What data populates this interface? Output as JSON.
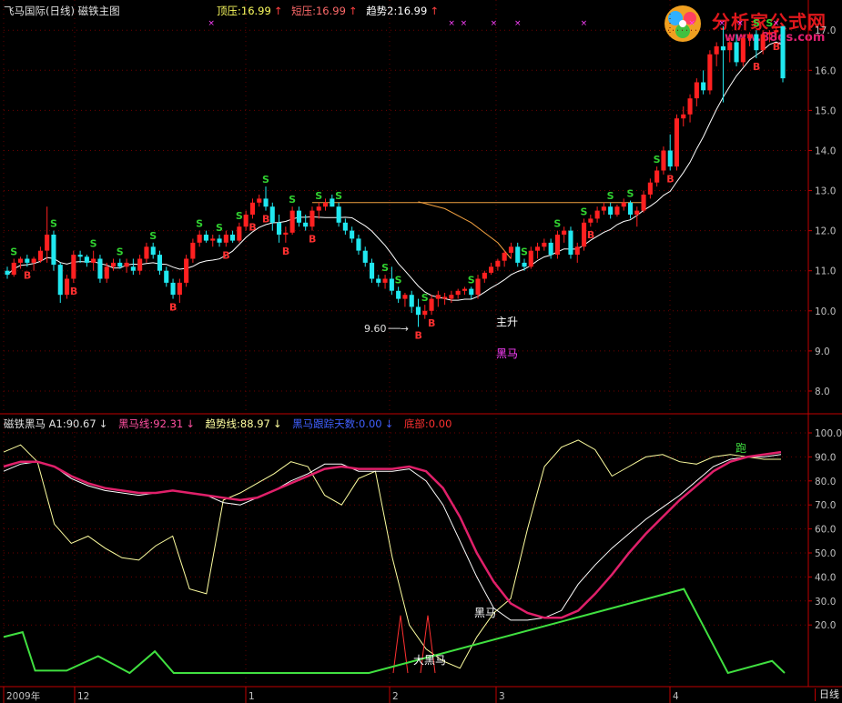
{
  "main_header": {
    "title": "飞马国际(日线)  磁铁主图",
    "top_press_label": "顶压:16.99",
    "short_press_label": "短压:16.99",
    "trend_label": "趋势2:16.99",
    "arrow": "↑"
  },
  "sub_header": {
    "title": "磁铁黑马  A1:90.67",
    "heima_line": "黑马线:92.31",
    "trend_line": "趋势线:88.97",
    "follow_days": "黑马跟踪天数:0.00",
    "bottom": "底部:0.00",
    "arrow": "↓"
  },
  "logo": {
    "name": "分析家公式网",
    "url": "www.88gs.com"
  },
  "annotations": {
    "low_price": "9.60",
    "main_rise": "主升",
    "dark_horse": "黑马",
    "sub_dark_horse": "黑马",
    "big_dark_horse": "大黑马",
    "run": "跑"
  },
  "price_axis": [
    "17.0",
    "16.0",
    "15.0",
    "14.0",
    "13.0",
    "12.0",
    "11.0",
    "10.0",
    "9.0",
    "8.0"
  ],
  "osc_axis": [
    "100.0",
    "90.0",
    "80.0",
    "70.0",
    "60.0",
    "50.0",
    "40.0",
    "30.0",
    "20.0"
  ],
  "date_axis": [
    "2009年",
    "12",
    "1",
    "2",
    "3",
    "4"
  ],
  "period_button": "日线",
  "colors": {
    "up": "#ff2020",
    "down": "#20e8f0",
    "buy": "#ff3030",
    "sell": "#30d030",
    "heima": "#e0206a",
    "trend": "#ffffa0",
    "green": "#40e040"
  },
  "chart_data": [
    {
      "type": "candlestick",
      "ylim": [
        7.5,
        17.3
      ],
      "candles": [
        [
          11.0,
          11.1,
          10.8,
          10.9
        ],
        [
          10.9,
          11.3,
          10.85,
          11.2
        ],
        [
          11.2,
          11.35,
          11.05,
          11.3
        ],
        [
          11.3,
          11.4,
          11.1,
          11.2
        ],
        [
          11.2,
          11.35,
          11.0,
          11.3
        ],
        [
          11.25,
          11.6,
          11.2,
          11.5
        ],
        [
          11.5,
          12.6,
          11.2,
          11.9
        ],
        [
          11.9,
          12.0,
          11.0,
          11.15
        ],
        [
          11.15,
          11.2,
          10.2,
          10.4
        ],
        [
          10.4,
          10.9,
          10.3,
          10.8
        ],
        [
          10.8,
          11.5,
          10.7,
          11.4
        ],
        [
          11.4,
          11.5,
          11.2,
          11.35
        ],
        [
          11.35,
          11.4,
          11.1,
          11.2
        ],
        [
          11.2,
          11.5,
          11.0,
          11.3
        ],
        [
          11.3,
          11.4,
          10.7,
          10.8
        ],
        [
          10.8,
          11.2,
          10.7,
          11.1
        ],
        [
          11.1,
          11.3,
          11.0,
          11.2
        ],
        [
          11.2,
          11.3,
          11.05,
          11.1
        ],
        [
          11.1,
          11.3,
          10.95,
          11.2
        ],
        [
          11.1,
          11.3,
          10.9,
          11.0
        ],
        [
          11.0,
          11.4,
          10.9,
          11.3
        ],
        [
          11.3,
          11.7,
          11.2,
          11.6
        ],
        [
          11.6,
          11.7,
          11.3,
          11.4
        ],
        [
          11.4,
          11.5,
          10.9,
          11.0
        ],
        [
          11.0,
          11.1,
          10.6,
          10.7
        ],
        [
          10.7,
          10.8,
          10.3,
          10.4
        ],
        [
          10.4,
          10.8,
          10.2,
          10.7
        ],
        [
          10.7,
          11.4,
          10.6,
          11.3
        ],
        [
          11.3,
          11.8,
          11.2,
          11.7
        ],
        [
          11.7,
          12.0,
          11.6,
          11.9
        ],
        [
          11.9,
          12.0,
          11.7,
          11.75
        ],
        [
          11.75,
          11.9,
          11.6,
          11.8
        ],
        [
          11.8,
          11.9,
          11.6,
          11.7
        ],
        [
          11.7,
          12.0,
          11.6,
          11.9
        ],
        [
          11.9,
          12.0,
          11.7,
          11.75
        ],
        [
          11.75,
          12.2,
          11.7,
          12.1
        ],
        [
          12.1,
          12.5,
          12.0,
          12.4
        ],
        [
          12.4,
          12.8,
          12.3,
          12.7
        ],
        [
          12.7,
          12.9,
          12.6,
          12.8
        ],
        [
          12.8,
          13.1,
          12.5,
          12.6
        ],
        [
          12.6,
          12.7,
          12.0,
          12.2
        ],
        [
          12.2,
          12.4,
          11.7,
          11.9
        ],
        [
          11.9,
          12.1,
          11.7,
          11.95
        ],
        [
          11.95,
          12.6,
          11.9,
          12.5
        ],
        [
          12.5,
          12.6,
          12.1,
          12.2
        ],
        [
          12.2,
          12.4,
          12.0,
          12.1
        ],
        [
          12.1,
          12.6,
          12.0,
          12.5
        ],
        [
          12.5,
          12.7,
          12.3,
          12.6
        ],
        [
          12.6,
          12.8,
          12.5,
          12.7
        ],
        [
          12.8,
          12.9,
          12.6,
          12.6
        ],
        [
          12.6,
          12.7,
          12.1,
          12.2
        ],
        [
          12.2,
          12.3,
          11.9,
          12.0
        ],
        [
          12.0,
          12.1,
          11.7,
          11.8
        ],
        [
          11.8,
          11.9,
          11.4,
          11.5
        ],
        [
          11.5,
          11.6,
          11.1,
          11.2
        ],
        [
          11.2,
          11.3,
          10.7,
          10.8
        ],
        [
          10.8,
          10.9,
          10.6,
          10.7
        ],
        [
          10.7,
          10.9,
          10.55,
          10.8
        ],
        [
          10.8,
          11.1,
          10.4,
          10.5
        ],
        [
          10.5,
          10.6,
          10.2,
          10.3
        ],
        [
          10.3,
          10.45,
          10.1,
          10.4
        ],
        [
          10.4,
          10.5,
          9.95,
          10.1
        ],
        [
          10.1,
          10.3,
          9.6,
          9.9
        ],
        [
          9.9,
          10.15,
          9.8,
          10.0
        ],
        [
          10.0,
          10.4,
          9.9,
          10.3
        ],
        [
          10.3,
          10.5,
          10.1,
          10.4
        ],
        [
          10.3,
          10.45,
          10.15,
          10.35
        ],
        [
          10.3,
          10.5,
          10.2,
          10.4
        ],
        [
          10.4,
          10.55,
          10.3,
          10.5
        ],
        [
          10.5,
          10.6,
          10.4,
          10.55
        ],
        [
          10.55,
          10.6,
          10.3,
          10.4
        ],
        [
          10.4,
          10.9,
          10.3,
          10.8
        ],
        [
          10.8,
          11.0,
          10.7,
          10.95
        ],
        [
          10.95,
          11.2,
          10.9,
          11.1
        ],
        [
          11.1,
          11.3,
          11.0,
          11.25
        ],
        [
          11.25,
          11.5,
          11.1,
          11.45
        ],
        [
          11.45,
          11.7,
          11.3,
          11.6
        ],
        [
          11.6,
          11.7,
          11.1,
          11.2
        ],
        [
          11.2,
          11.3,
          11.0,
          11.1
        ],
        [
          11.1,
          11.6,
          11.05,
          11.5
        ],
        [
          11.5,
          11.7,
          11.3,
          11.6
        ],
        [
          11.6,
          11.8,
          11.5,
          11.7
        ],
        [
          11.7,
          11.8,
          11.3,
          11.4
        ],
        [
          11.4,
          12.0,
          11.3,
          11.9
        ],
        [
          11.9,
          12.1,
          11.7,
          12.0
        ],
        [
          12.0,
          12.1,
          11.3,
          11.4
        ],
        [
          11.4,
          11.7,
          11.2,
          11.6
        ],
        [
          11.6,
          12.3,
          11.5,
          12.2
        ],
        [
          12.2,
          12.4,
          12.1,
          12.3
        ],
        [
          12.3,
          12.6,
          12.2,
          12.5
        ],
        [
          12.5,
          12.7,
          12.4,
          12.6
        ],
        [
          12.6,
          12.7,
          12.3,
          12.4
        ],
        [
          12.4,
          12.65,
          12.35,
          12.6
        ],
        [
          12.6,
          12.8,
          12.5,
          12.7
        ],
        [
          12.7,
          12.75,
          12.3,
          12.4
        ],
        [
          12.4,
          12.6,
          12.1,
          12.5
        ],
        [
          12.5,
          13.0,
          12.45,
          12.9
        ],
        [
          12.9,
          13.3,
          12.8,
          13.2
        ],
        [
          13.2,
          13.6,
          13.1,
          13.5
        ],
        [
          13.5,
          14.1,
          13.4,
          14.0
        ],
        [
          14.0,
          14.4,
          13.5,
          13.6
        ],
        [
          13.6,
          14.9,
          13.5,
          14.8
        ],
        [
          14.8,
          15.1,
          14.6,
          14.9
        ],
        [
          14.9,
          15.4,
          14.7,
          15.3
        ],
        [
          15.3,
          15.8,
          15.1,
          15.7
        ],
        [
          15.7,
          16.0,
          15.4,
          15.5
        ],
        [
          15.5,
          16.5,
          15.4,
          16.4
        ],
        [
          16.4,
          16.7,
          16.1,
          16.6
        ],
        [
          16.6,
          17.1,
          15.2,
          16.5
        ],
        [
          16.5,
          16.8,
          16.2,
          16.7
        ],
        [
          16.7,
          16.9,
          16.1,
          16.2
        ],
        [
          16.2,
          16.9,
          16.1,
          16.8
        ],
        [
          16.8,
          16.95,
          16.6,
          16.9
        ],
        [
          16.9,
          17.0,
          16.3,
          16.5
        ],
        [
          16.5,
          17.0,
          16.4,
          16.9
        ],
        [
          16.9,
          17.0,
          16.7,
          16.95
        ],
        [
          16.95,
          17.1,
          16.8,
          17.0
        ],
        [
          17.1,
          17.1,
          15.7,
          15.8
        ]
      ],
      "buy_points": [
        3,
        10,
        25,
        33,
        37,
        39,
        42,
        46,
        62,
        64,
        88,
        100,
        113,
        116
      ],
      "sell_points": [
        1,
        7,
        13,
        17,
        22,
        29,
        32,
        35,
        39,
        43,
        47,
        50,
        57,
        59,
        63,
        70,
        78,
        83,
        87,
        91,
        94,
        98,
        113,
        115
      ],
      "resistance": 12.7,
      "osc_lines": {
        "heima": [
          86,
          88,
          88,
          86,
          82,
          79,
          77,
          76,
          75,
          75,
          76,
          75,
          74,
          73,
          72,
          73,
          76,
          79,
          82,
          85,
          86,
          85,
          85,
          85,
          86,
          84,
          77,
          65,
          50,
          38,
          29,
          25,
          23,
          23,
          26,
          33,
          41,
          50,
          58,
          65,
          72,
          78,
          84,
          88,
          90,
          91,
          92
        ],
        "trend": [
          92,
          95,
          88,
          62,
          54,
          57,
          52,
          48,
          47,
          53,
          57,
          35,
          33,
          72,
          75,
          79,
          83,
          88,
          86,
          74,
          70,
          81,
          84,
          48,
          20,
          10,
          5,
          2,
          15,
          25,
          31,
          60,
          86,
          94,
          97,
          93,
          82,
          86,
          90,
          91,
          88,
          87,
          90,
          91,
          90,
          89,
          89
        ],
        "a1": [
          84,
          87,
          88,
          86,
          81,
          78,
          76,
          75,
          74,
          75,
          76,
          75,
          74,
          71,
          70,
          73,
          76,
          80,
          83,
          87,
          87,
          84,
          84,
          84,
          85,
          80,
          70,
          55,
          40,
          27,
          22,
          22,
          23,
          26,
          37,
          45,
          52,
          58,
          64,
          69,
          74,
          80,
          86,
          89,
          90,
          90,
          91
        ]
      },
      "green_ramp": [
        [
          0,
          15
        ],
        [
          3,
          17
        ],
        [
          5,
          1
        ],
        [
          10,
          1
        ],
        [
          15,
          7
        ],
        [
          20,
          0
        ],
        [
          24,
          9
        ],
        [
          27,
          0
        ],
        [
          33,
          0
        ],
        [
          37,
          0
        ],
        [
          58,
          0
        ],
        [
          108,
          35
        ],
        [
          115,
          0
        ],
        [
          122,
          5
        ],
        [
          124,
          0
        ]
      ]
    }
  ]
}
